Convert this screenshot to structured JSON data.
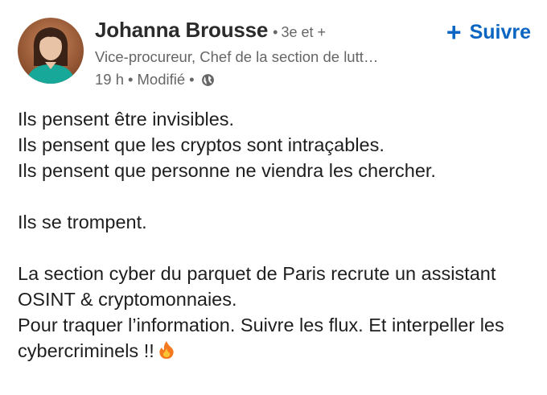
{
  "author": {
    "name": "Johanna Brousse",
    "degree": "3e et +",
    "headline": "Vice-procureur, Chef de la section de lutt…",
    "time": "19 h",
    "edited": "Modifié",
    "visibility_icon": "globe-icon"
  },
  "follow": {
    "icon": "plus-icon",
    "label": "Suivre"
  },
  "post": {
    "lines": [
      "Ils pensent être invisibles.",
      "Ils pensent que les cryptos sont intraçables.",
      "Ils pensent que personne ne viendra les chercher.",
      "Ils se trompent.",
      "La section cyber du parquet de Paris recrute un assistant",
      "OSINT & cryptomonnaies.",
      "Pour traquer l’information. Suivre les flux. Et interpeller les",
      "cybercriminels !!"
    ],
    "trailing_icon": "fire-icon"
  },
  "colors": {
    "accent": "#0a66c2",
    "muted_text": "#666666",
    "body_text": "#1e1e1e"
  }
}
